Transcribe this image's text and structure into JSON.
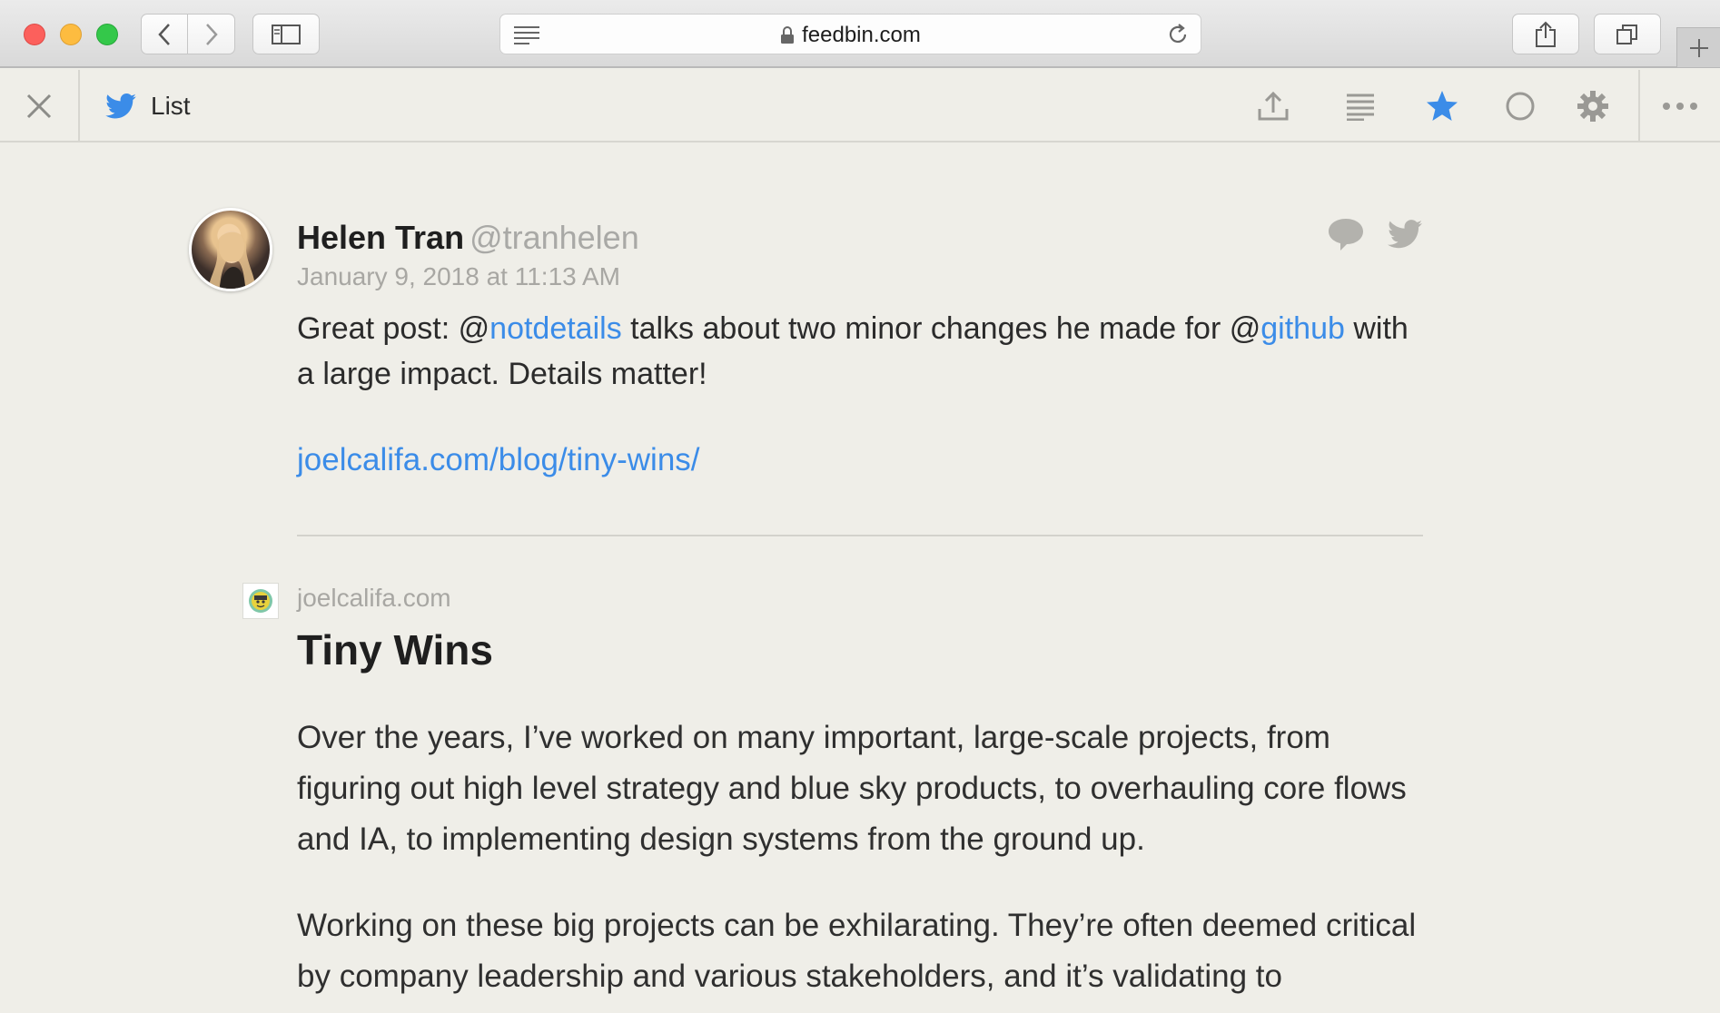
{
  "browser": {
    "url": "feedbin.com",
    "icons": [
      "back-icon",
      "forward-icon",
      "sidebar-icon",
      "reader-icon",
      "lock-icon",
      "reload-icon",
      "share-icon",
      "tabs-icon",
      "plus-icon"
    ]
  },
  "header": {
    "feed_title": "List",
    "icons": [
      "close-icon",
      "twitter-bird-icon",
      "share-icon",
      "extract-icon",
      "star-icon",
      "unread-circle-icon",
      "settings-gear-icon",
      "more-icon"
    ],
    "accent_color": "#3b8ce8"
  },
  "tweet": {
    "author": "Helen Tran",
    "handle": "@tranhelen",
    "date": "January 9, 2018 at 11:13 AM",
    "text_1": "Great post: @",
    "mention_1": "notdetails",
    "text_2": " talks about two minor changes he made for @",
    "mention_2": "github",
    "text_3": " with a large impact. Details matter!",
    "link": "joelcalifa.com/blog/tiny-wins/"
  },
  "article": {
    "domain": "joelcalifa.com",
    "title": "Tiny Wins",
    "paragraph_1": "Over the years, I’ve worked on many important, large-scale projects, from figuring out high level strategy and blue sky products, to overhauling core flows and IA, to implementing design systems from the ground up.",
    "paragraph_2": "Working on these big projects can be exhilarating. They’re often deemed critical by company leadership and various stakeholders, and it’s validating to"
  }
}
